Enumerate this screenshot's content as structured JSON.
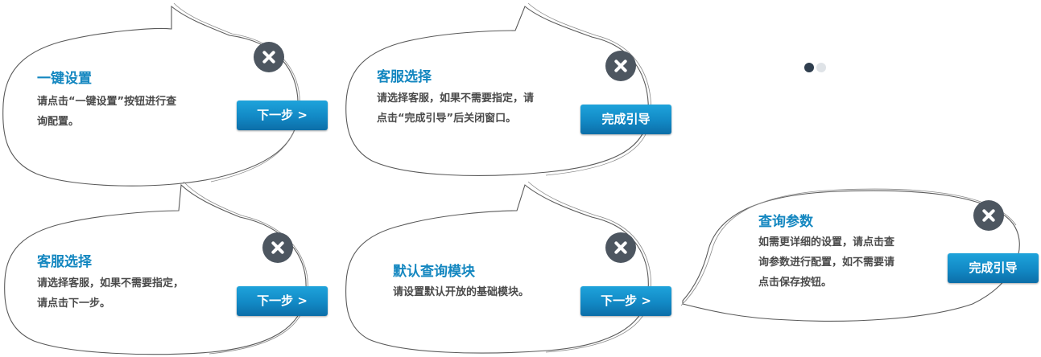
{
  "cards": [
    {
      "id": "card-1",
      "title": "一键设置",
      "desc_lines": [
        "请点击“一键设置”按钮进行查",
        "询配置。"
      ],
      "button": "下一步 >"
    },
    {
      "id": "card-2",
      "title": "客服选择",
      "desc_lines": [
        "请选择客服，如果不需要指定，请",
        "点击“完成引导”后关闭窗口。"
      ],
      "button": "完成引导"
    },
    {
      "id": "card-3",
      "title": "客服选择",
      "desc_lines": [
        "请选择客服，如果不需要指定，",
        "请点击下一步。"
      ],
      "button": "下一步 >"
    },
    {
      "id": "card-4",
      "title": "默认查询模块",
      "desc_lines": [
        "请设置默认开放的基础模块。"
      ],
      "button": "下一步 >"
    },
    {
      "id": "card-5",
      "title": "查询参数",
      "desc_lines": [
        "如需更详细的设置，请点击查",
        "询参数进行配置，如不需要请",
        "点击保存按钮。"
      ],
      "button": "完成引导"
    }
  ],
  "pager": {
    "total": 2,
    "active": 1
  },
  "colors": {
    "title": "#1487c0",
    "button": "#1289c5",
    "close": "#4d5660",
    "dot_active": "#2f3e4e",
    "dot_inactive": "#dfe3e7"
  }
}
